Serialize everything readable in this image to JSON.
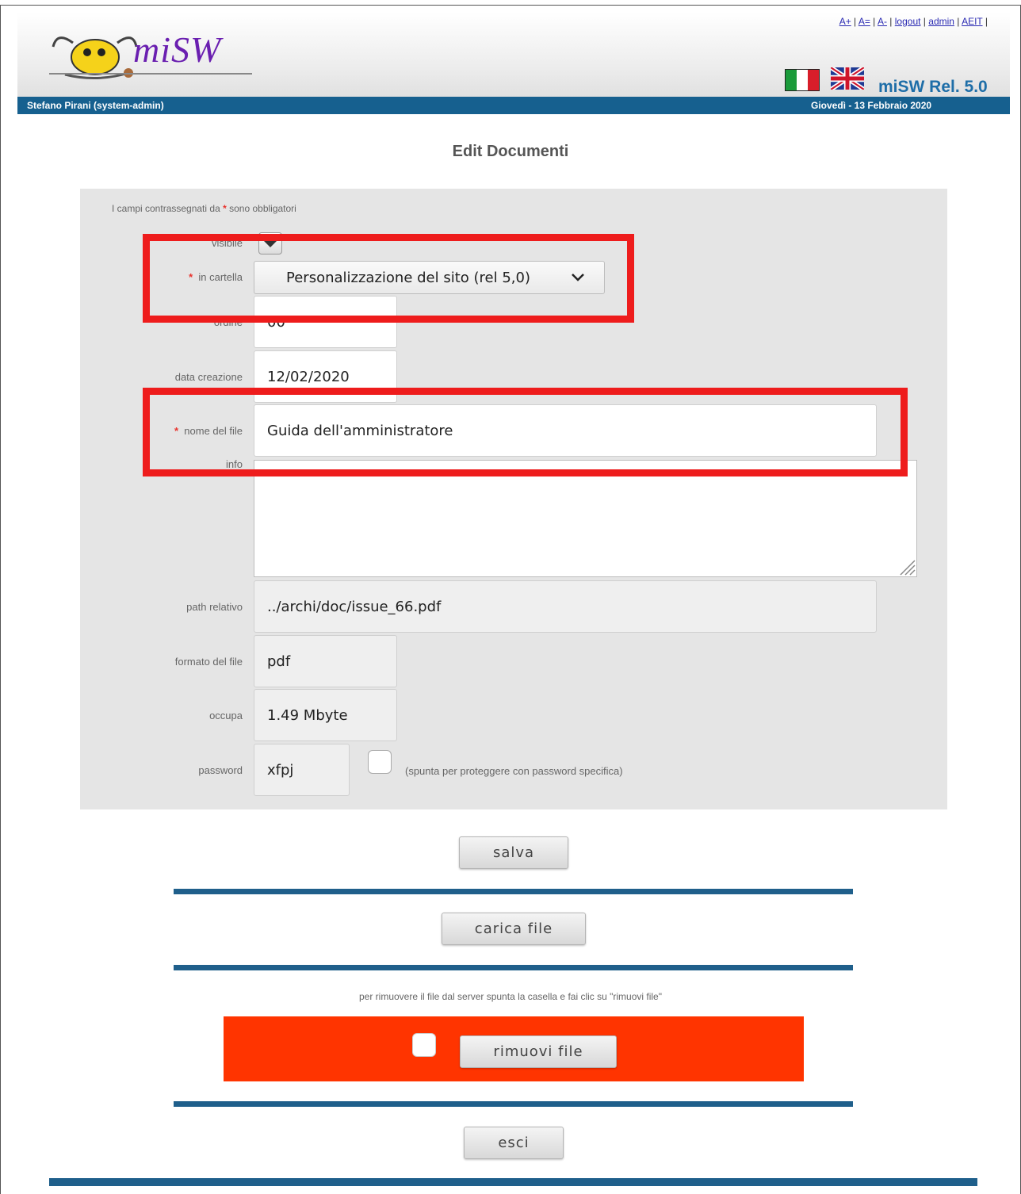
{
  "header": {
    "top_links": [
      "A+",
      "A=",
      "A-",
      "logout",
      "admin",
      "AEIT"
    ],
    "logo_text": "miSW",
    "release": "miSW Rel. 5.0",
    "user": "Stefano Pirani (system-admin)",
    "date": "Giovedì - 13 Febbraio 2020"
  },
  "page": {
    "title": "Edit Documenti"
  },
  "form": {
    "required_note_prefix": "I campi contrassegnati da",
    "required_note_star": "*",
    "required_note_suffix": "sono obbligatori",
    "visibile_label": "visibile",
    "cartella_label": "in cartella",
    "cartella_value": "Personalizzazione del sito (rel 5,0)",
    "ordine_label": "ordine",
    "ordine_value": "00",
    "data_label": "data creazione",
    "data_value": "12/02/2020",
    "nome_label": "nome del file",
    "nome_value": "Guida dell'amministratore",
    "info_label": "info",
    "info_value": "",
    "path_label": "path relativo",
    "path_value": "../archi/doc/issue_66.pdf",
    "formato_label": "formato del file",
    "formato_value": "pdf",
    "occupa_label": "occupa",
    "occupa_value": "1.49 Mbyte",
    "password_label": "password",
    "password_value": "xfpj",
    "password_note": "(spunta per proteggere con password specifica)"
  },
  "buttons": {
    "save": "salva",
    "upload": "carica file",
    "remove": "rimuovi file",
    "exit": "esci"
  },
  "remove_note": "per rimuovere il file dal server spunta la casella e fai clic su \"rimuovi file\"",
  "colors": {
    "header_bar": "#16608f",
    "remove_panel": "#ff3400",
    "highlight": "#ee1c1c",
    "panel_bg": "#e5e5e5"
  }
}
